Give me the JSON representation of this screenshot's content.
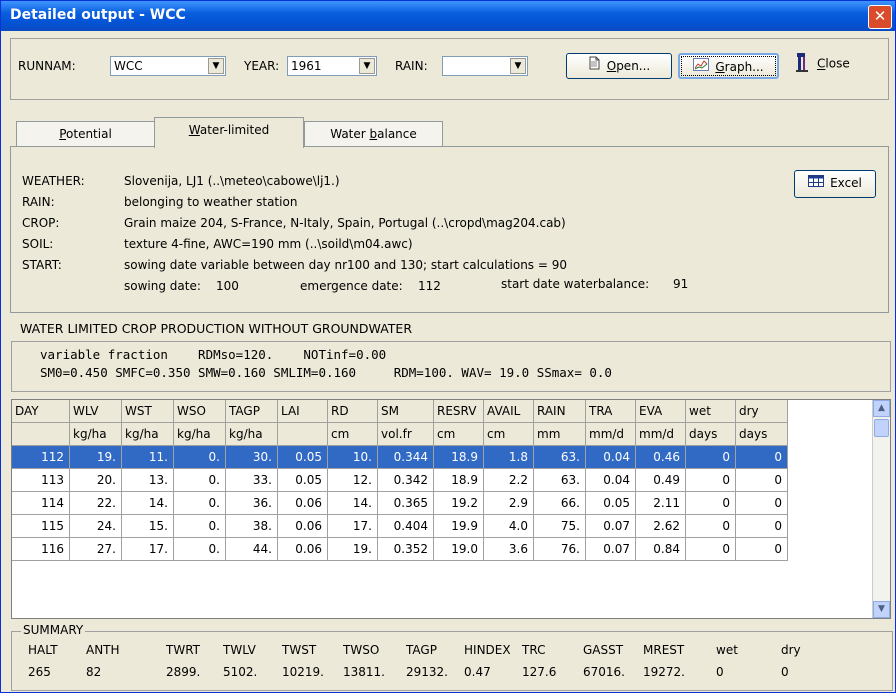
{
  "window": {
    "title": "Detailed output - WCC",
    "close_glyph": "✕"
  },
  "toolbar": {
    "runnam_label": "RUNNAM:",
    "runnam_value": "WCC",
    "year_label": "YEAR:",
    "year_value": "1961",
    "rain_label": "RAIN:",
    "rain_value": "",
    "open_label": "Open...",
    "graph_label": "Graph...",
    "close_label": "Close"
  },
  "tabs": [
    {
      "label": "Potential"
    },
    {
      "label": "Water-limited"
    },
    {
      "label": "Water balance"
    }
  ],
  "info": {
    "weather_label": "WEATHER:",
    "weather_value": "Slovenija, LJ1 (..\\meteo\\cabowe\\lj1.)",
    "rain_label": "RAIN:",
    "rain_value": "belonging to weather station",
    "crop_label": "CROP:",
    "crop_value": "Grain maize 204, S-France, N-Italy, Spain, Portugal (..\\cropd\\mag204.cab)",
    "soil_label": "SOIL:",
    "soil_value": "texture 4-fine, AWC=190 mm (..\\soild\\m04.awc)",
    "start_label": "START:",
    "start_value": "sowing date variable between day nr100 and 130;  start calculations = 90",
    "sowing_label": "sowing date:",
    "sowing_value": "100",
    "emergence_label": "emergence date:",
    "emergence_value": "112",
    "waterbalance_label": "start date waterbalance:",
    "waterbalance_value": "91",
    "excel_label": "Excel"
  },
  "section_title": "WATER LIMITED CROP PRODUCTION WITHOUT GROUNDWATER",
  "params": {
    "line1": "variable fraction    RDMso=120.    NOTinf=0.00",
    "line2": "SM0=0.450 SMFC=0.350 SMW=0.160 SMLIM=0.160     RDM=100. WAV= 19.0 SSmax= 0.0"
  },
  "table": {
    "headers": [
      "DAY",
      "WLV",
      "WST",
      "WSO",
      "TAGP",
      "LAI",
      "RD",
      "SM",
      "RESRV",
      "AVAIL",
      "RAIN",
      "TRA",
      "EVA",
      "wet",
      "dry"
    ],
    "units": [
      "",
      "kg/ha",
      "kg/ha",
      "kg/ha",
      "kg/ha",
      "",
      "cm",
      "vol.fr",
      "cm",
      "cm",
      "mm",
      "mm/d",
      "mm/d",
      "days",
      "days"
    ],
    "rows": [
      [
        "112",
        "19.",
        "11.",
        "0.",
        "30.",
        "0.05",
        "10.",
        "0.344",
        "18.9",
        "1.8",
        "63.",
        "0.04",
        "0.46",
        "0",
        "0"
      ],
      [
        "113",
        "20.",
        "13.",
        "0.",
        "33.",
        "0.05",
        "12.",
        "0.342",
        "18.9",
        "2.2",
        "63.",
        "0.04",
        "0.49",
        "0",
        "0"
      ],
      [
        "114",
        "22.",
        "14.",
        "0.",
        "36.",
        "0.06",
        "14.",
        "0.365",
        "19.2",
        "2.9",
        "66.",
        "0.05",
        "2.11",
        "0",
        "0"
      ],
      [
        "115",
        "24.",
        "15.",
        "0.",
        "38.",
        "0.06",
        "17.",
        "0.404",
        "19.9",
        "4.0",
        "75.",
        "0.07",
        "2.62",
        "0",
        "0"
      ],
      [
        "116",
        "27.",
        "17.",
        "0.",
        "44.",
        "0.06",
        "19.",
        "0.352",
        "19.0",
        "3.6",
        "76.",
        "0.07",
        "0.84",
        "0",
        "0"
      ]
    ]
  },
  "summary": {
    "title": "SUMMARY",
    "headers": [
      "HALT",
      "ANTH",
      "TWRT",
      "TWLV",
      "TWST",
      "TWSO",
      "TAGP",
      "HINDEX",
      "TRC",
      "GASST",
      "MREST",
      "wet",
      "dry"
    ],
    "values": [
      "265",
      "82",
      "2899.",
      "5102.",
      "10219.",
      "13811.",
      "29132.",
      "0.47",
      "127.6",
      "67016.",
      "19272.",
      "0",
      "0"
    ]
  }
}
